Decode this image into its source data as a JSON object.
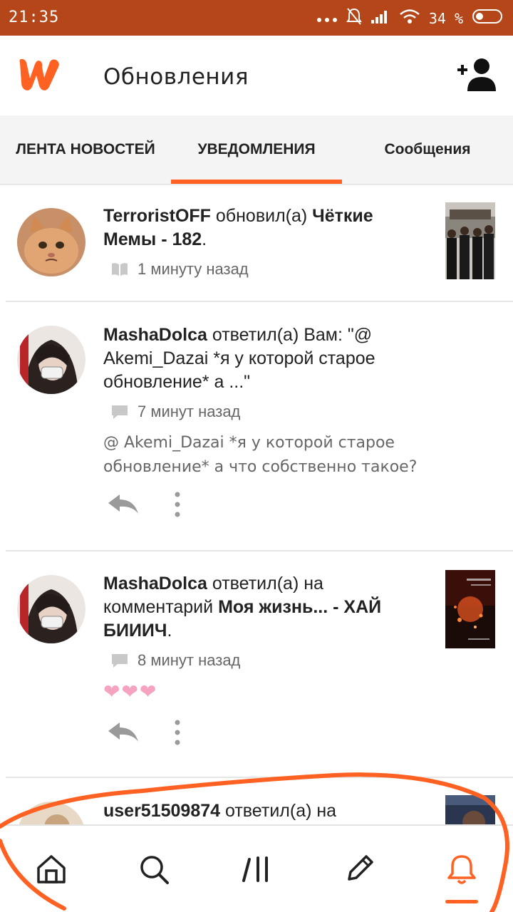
{
  "status_bar": {
    "time": "21:35",
    "battery": "34 %"
  },
  "header": {
    "title": "Обновления"
  },
  "tabs": [
    {
      "label": "ЛЕНТА НОВОСТЕЙ"
    },
    {
      "label": "УВЕДОМЛЕНИЯ"
    },
    {
      "label": "Сообщения"
    }
  ],
  "notifications": [
    {
      "user": "TerroristOFF",
      "action": " обновил(а) ",
      "target": "Чёткие Мемы - 182",
      "suffix": ".",
      "time": "1 минуту назад",
      "icon": "book-icon"
    },
    {
      "user": "MashaDolca",
      "action": " ответил(а) Вам: \"@ Akemi_Dazai *я у которой старое обновление* а ...\"",
      "time": "7 минут назад",
      "icon": "comment-icon",
      "comment": "@ Akemi_Dazai  *я у которой старое обновление* а что собственно такое?"
    },
    {
      "user": "MashaDolca",
      "action": " ответил(а) на комментарий ",
      "target": "Моя жизнь... - ХАЙ БИИИЧ",
      "suffix": ".",
      "time": "8 минут назад",
      "icon": "comment-icon",
      "comment": "❤❤❤"
    },
    {
      "user": "user51509874",
      "action": " ответил(а) на"
    }
  ],
  "bottom_nav": [
    "home-icon",
    "search-icon",
    "library-icon",
    "write-icon",
    "bell-icon"
  ],
  "colors": {
    "accent": "#ff6122",
    "status_bar": "#b5461a"
  }
}
